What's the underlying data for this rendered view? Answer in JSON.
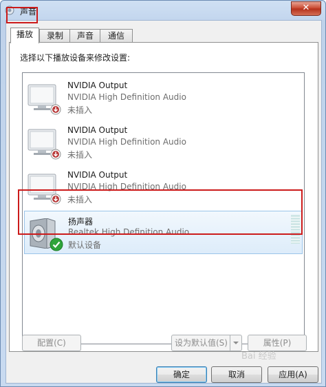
{
  "window": {
    "title": "声音",
    "close_glyph": "✕"
  },
  "tabs": [
    {
      "label": "播放",
      "active": true
    },
    {
      "label": "录制",
      "active": false
    },
    {
      "label": "声音",
      "active": false
    },
    {
      "label": "通信",
      "active": false
    }
  ],
  "panel": {
    "prompt": "选择以下播放设备来修改设置:"
  },
  "devices": [
    {
      "name": "NVIDIA Output",
      "description": "NVIDIA High Definition Audio",
      "status": "未插入",
      "icon": "monitor-icon",
      "badge": "unplugged-badge-icon"
    },
    {
      "name": "NVIDIA Output",
      "description": "NVIDIA High Definition Audio",
      "status": "未插入",
      "icon": "monitor-icon",
      "badge": "unplugged-badge-icon"
    },
    {
      "name": "NVIDIA Output",
      "description": "NVIDIA High Definition Audio",
      "status": "未插入",
      "icon": "monitor-icon",
      "badge": "unplugged-badge-icon"
    },
    {
      "name": "扬声器",
      "description": "Realtek High Definition Audio",
      "status": "默认设备",
      "icon": "speaker-icon",
      "badge": "default-check-icon",
      "selected": true
    }
  ],
  "buttons": {
    "configure": "配置(C)",
    "set_default": "设为默认值(S)",
    "properties": "属性(P)",
    "ok": "确定",
    "cancel": "取消",
    "apply": "应用(A)"
  },
  "watermark": "Bai 经验",
  "colors": {
    "highlight": "#cc1a1a",
    "accent": "#3c7fb1"
  }
}
